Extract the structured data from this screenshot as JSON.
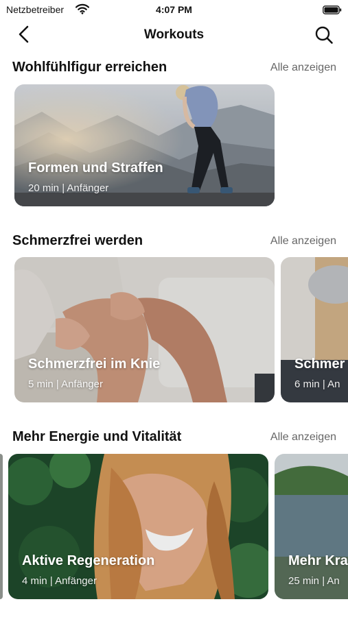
{
  "status_bar": {
    "carrier": "Netzbetreiber",
    "time": "4:07 PM"
  },
  "nav": {
    "title": "Workouts",
    "back_icon": "chevron-left-icon",
    "search_icon": "search-icon"
  },
  "sections": [
    {
      "title": "Wohlfühlfigur erreichen",
      "link": "Alle anzeigen",
      "cards": [
        {
          "title": "Formen und Straffen",
          "meta": "20 min | Anfänger"
        }
      ]
    },
    {
      "title": "Schmerzfrei werden",
      "link": "Alle anzeigen",
      "cards": [
        {
          "title": "Schmerzfrei im Knie",
          "meta": "5 min | Anfänger"
        },
        {
          "title": "Schmer",
          "meta": "6 min | An"
        }
      ]
    },
    {
      "title": "Mehr Energie und Vitalität",
      "link": "Alle anzeigen",
      "cards": [
        {
          "title": "Aktive Regeneration",
          "meta": "4 min | Anfänger"
        },
        {
          "title": "Mehr Kra",
          "meta": "25 min | An"
        }
      ]
    }
  ]
}
